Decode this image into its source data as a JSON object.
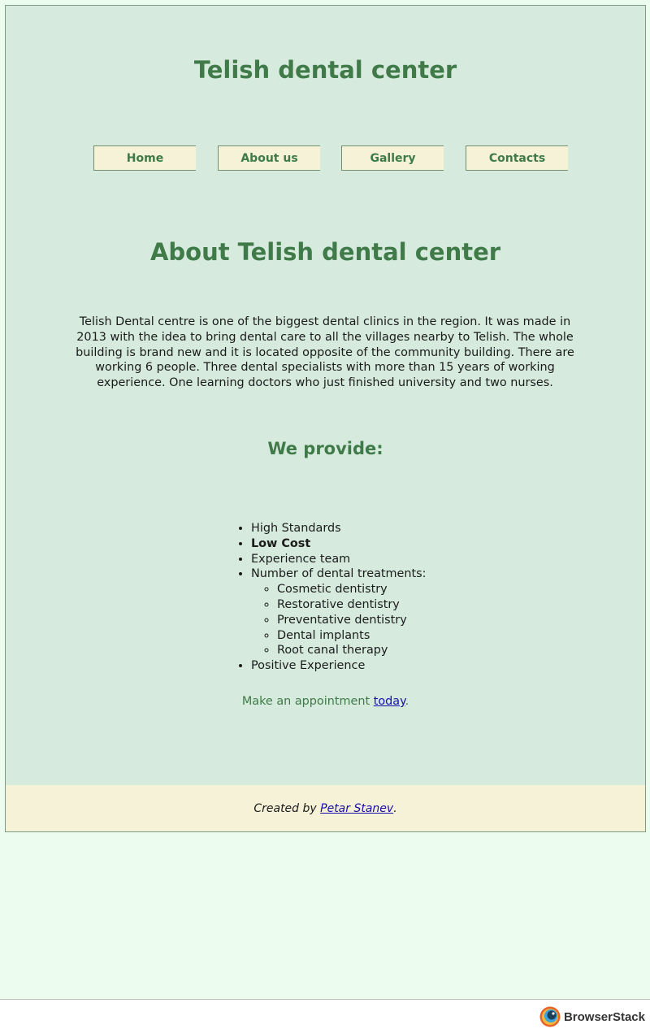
{
  "site": {
    "title": "Telish dental center"
  },
  "nav": {
    "items": [
      {
        "label": "Home"
      },
      {
        "label": "About us"
      },
      {
        "label": "Gallery"
      },
      {
        "label": "Contacts"
      }
    ]
  },
  "main": {
    "title": "About Telish dental center",
    "about_text": "Telish Dental centre is one of the biggest dental clinics in the region. It was made in 2013 with the idea to bring dental care to all the villages nearby to Telish. The whole building is brand new and it is located opposite of the community building. There are working 6 people. Three dental specialists with more than 15 years of working experience. One learning doctors who just finished university and two nurses.",
    "provide_title": "We provide:",
    "features": [
      "High Standards",
      "Low Cost",
      "Experience team",
      "Number of dental treatments:",
      "Positive Experience"
    ],
    "treatments": [
      "Cosmetic dentistry",
      "Restorative dentistry",
      "Preventative dentistry",
      "Dental implants",
      "Root canal therapy"
    ],
    "appointment_prefix": "Make an appointment ",
    "appointment_link": "today",
    "appointment_suffix": "."
  },
  "footer": {
    "prefix": "Created by ",
    "author_link": "Petar Stanev",
    "suffix": "."
  },
  "browser_bar": {
    "brand": "BrowserStack"
  },
  "colors": {
    "page_bg": "#d6ebde",
    "outer_bg": "#ecfcee",
    "accent_green": "#3f7a48",
    "nav_button_bg": "#f5f2d8",
    "footer_bg": "#f5f2d8",
    "link": "#1a0dab"
  }
}
